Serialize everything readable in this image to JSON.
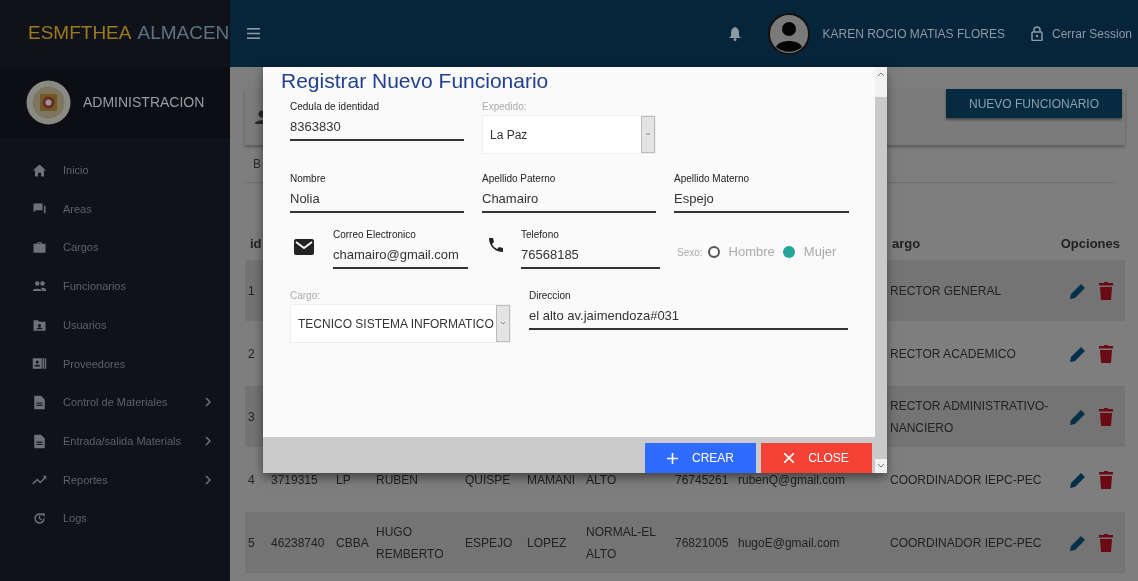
{
  "brand": {
    "part_1": "ESMFTHEA",
    "part_2": "ALMACEN"
  },
  "sidebar": {
    "section_title": "ADMINISTRACION",
    "items": [
      {
        "label": "Inicio",
        "expandable": false
      },
      {
        "label": "Areas",
        "expandable": false
      },
      {
        "label": "Cargos",
        "expandable": false
      },
      {
        "label": "Funcionarios",
        "expandable": false
      },
      {
        "label": "Usuarios",
        "expandable": false
      },
      {
        "label": "Proveedores",
        "expandable": false
      },
      {
        "label": "Control de Materiales",
        "expandable": true
      },
      {
        "label": "Entrada/salida Materials",
        "expandable": true
      },
      {
        "label": "Reportes",
        "expandable": true
      },
      {
        "label": "Logs",
        "expandable": false
      }
    ]
  },
  "top_bar": {
    "user_name": "KAREN ROCIO MATIAS FLORES",
    "logout": "Cerrar Session"
  },
  "page": {
    "new_button": "NUEVO FUNCIONARIO",
    "search_label": "B",
    "table": {
      "id_header": "id",
      "cargo_header": "argo",
      "options_header": "Opciones",
      "rows": [
        {
          "cells": [
            "1",
            null,
            null,
            null,
            null,
            null,
            null,
            null,
            null,
            "RECTOR GENERAL"
          ]
        },
        {
          "cells": [
            "2",
            null,
            null,
            null,
            null,
            null,
            null,
            null,
            null,
            "RECTOR ACADEMICO"
          ]
        },
        {
          "cells": [
            "3",
            null,
            null,
            null,
            null,
            null,
            null,
            null,
            null,
            "RECTOR ADMINISTRATIVO-\nNANCIERO"
          ]
        },
        {
          "cells": [
            "4",
            "3719315",
            "LP",
            "RUBEN",
            "QUISPE",
            "MAMANI",
            "ALTO",
            "76745261",
            "rubenQ@gmail.com",
            "COORDINADOR IEPC-PEC"
          ]
        },
        {
          "cells": [
            "5",
            "46238740",
            "CBBA",
            "HUGO\nREMBERTO",
            "ESPEJO",
            "LOPEZ",
            "NORMAL-EL\nALTO",
            "76821005",
            "hugoE@gmail.com",
            "COORDINADOR IEPC-PEC"
          ]
        }
      ]
    }
  },
  "modal": {
    "title": "Registrar Nuevo Funcionario",
    "ci": {
      "label": "Cedula de identidad",
      "value": "8363830"
    },
    "expedido": {
      "label": "Expedido:",
      "value": "La Paz"
    },
    "nombre": {
      "label": "Nombre",
      "value": "Nolia"
    },
    "paterno": {
      "label": "Apellido Paterno",
      "value": "Chamairo"
    },
    "materno": {
      "label": "Apellido Materno",
      "value": "Espejo"
    },
    "correo": {
      "label": "Correo Electronico",
      "value": "chamairo@gmail.com"
    },
    "telefono": {
      "label": "Telefono",
      "value": "76568185"
    },
    "sexo": {
      "label": "Sexo:",
      "options": [
        {
          "label": "Hombre",
          "selected": false
        },
        {
          "label": "Mujer",
          "selected": true
        }
      ]
    },
    "cargo": {
      "label": "Cargo:",
      "value": "TECNICO SISTEMA INFORMATICO"
    },
    "direccion": {
      "label": "Direccion",
      "value": "el alto av.jaimendoza#031"
    },
    "buttons": [
      {
        "label": "CREAR",
        "kind": "create"
      },
      {
        "label": "CLOSE",
        "kind": "close"
      }
    ]
  }
}
